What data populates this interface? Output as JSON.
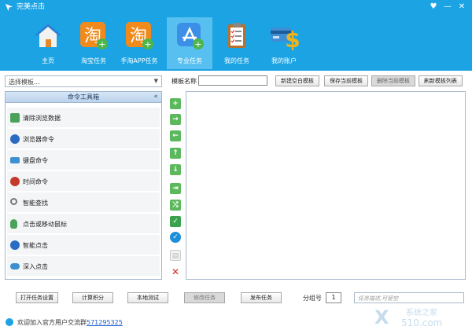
{
  "window": {
    "title": "完美点击",
    "controls": [
      "♥",
      "—",
      "✕"
    ]
  },
  "nav": {
    "items": [
      {
        "label": "主页",
        "icon": "home-icon"
      },
      {
        "label": "淘宝任务",
        "icon": "taobao-icon"
      },
      {
        "label": "手淘APP任务",
        "icon": "taobao-app-icon"
      },
      {
        "label": "专业任务",
        "icon": "app-store-icon",
        "active": true
      },
      {
        "label": "我的任务",
        "icon": "clipboard-icon"
      },
      {
        "label": "我的账户",
        "icon": "dollar-card-icon"
      }
    ]
  },
  "left": {
    "template_select_placeholder": "选择模板...",
    "toolbox_title": "命令工具箱",
    "toolbox_collapse": "«",
    "commands": [
      {
        "label": "清除浏览数据",
        "icon": "broom-icon",
        "color": "#4aa25a"
      },
      {
        "label": "浏览器命令",
        "icon": "browser-icon",
        "color": "#2a6cc4"
      },
      {
        "label": "键盘命令",
        "icon": "keyboard-icon",
        "color": "#3c8fd0"
      },
      {
        "label": "时间命令",
        "icon": "clock-icon",
        "color": "#c23a2a"
      },
      {
        "label": "智能查找",
        "icon": "magnifier-icon",
        "color": "#777777"
      },
      {
        "label": "点击或移动鼠标",
        "icon": "mouse-icon",
        "color": "#4aa25a"
      },
      {
        "label": "智能点击",
        "icon": "smart-click-icon",
        "color": "#2a6cc4"
      },
      {
        "label": "深入点击",
        "icon": "cloud-icon",
        "color": "#3c8fd0"
      }
    ]
  },
  "tools": [
    {
      "name": "add-command-icon",
      "glyph": "+",
      "color": "#5cb85c"
    },
    {
      "name": "move-right-icon",
      "glyph": "→",
      "color": "#5cb85c"
    },
    {
      "name": "move-left-icon",
      "glyph": "←",
      "color": "#5cb85c"
    },
    {
      "name": "move-up-icon",
      "glyph": "↑",
      "color": "#5cb85c"
    },
    {
      "name": "move-down-icon",
      "glyph": "↓",
      "color": "#5cb85c"
    },
    {
      "name": "forward-icon",
      "glyph": "⇥",
      "color": "#5cb85c"
    },
    {
      "name": "shuffle-icon",
      "glyph": "⤮",
      "color": "#5cb85c"
    },
    {
      "name": "shield-check-icon",
      "glyph": "✓",
      "color": "#3aa14d"
    },
    {
      "name": "check-circle-icon",
      "glyph": "✓",
      "color": "#1d8fd8"
    },
    {
      "name": "document-icon",
      "glyph": "▤",
      "color": "#cfcfcf"
    },
    {
      "name": "delete-icon",
      "glyph": "✕",
      "color": "#d9261c"
    }
  ],
  "editor": {
    "template_name_label": "模板名称",
    "buttons": {
      "new_template": "新建空白模板",
      "save_template": "保存当前模板",
      "delete_template": "删除当前模板",
      "refresh_list": "刷新模板列表"
    }
  },
  "bottom": {
    "open_settings": "打开任务设置",
    "calc_points": "计算积分",
    "local_test": "本地测试",
    "modify_task": "修改任务",
    "publish_task": "发布任务",
    "group_label": "分组号",
    "group_value": "1",
    "desc_placeholder": "任务描述,可留空"
  },
  "status": {
    "text": "欢迎加入官方用户交流群",
    "link": "571295325"
  },
  "watermark": {
    "text": "系统之家",
    "sub": "510.com"
  },
  "colors": {
    "header": "#1ba3e4",
    "nav_active": "#57c0f0"
  }
}
